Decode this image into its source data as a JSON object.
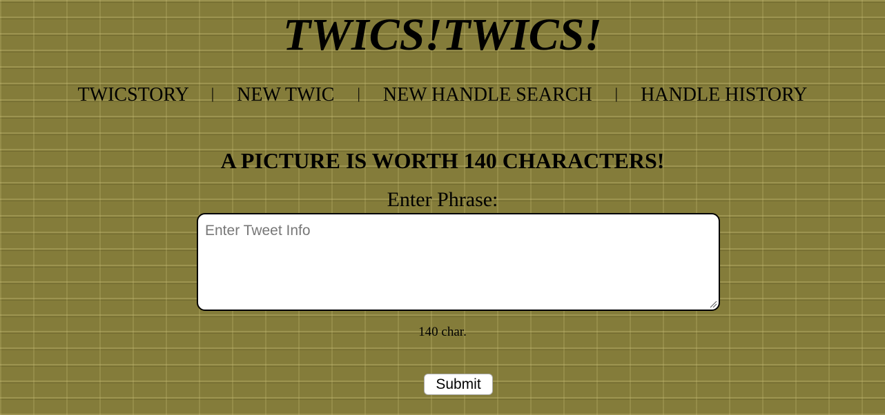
{
  "header": {
    "title": "TWICS!TWICS!"
  },
  "nav": {
    "items": [
      {
        "label": "TWICSTORY"
      },
      {
        "label": "NEW TWIC"
      },
      {
        "label": "NEW HANDLE SEARCH"
      },
      {
        "label": "HANDLE HISTORY"
      }
    ],
    "separator": "|"
  },
  "main": {
    "headline": "A PICTURE IS WORTH 140 CHARACTERS!",
    "phrase_label": "Enter Phrase:",
    "phrase_input": {
      "value": "",
      "placeholder": "Enter Tweet Info"
    },
    "char_counter": "140 char.",
    "submit_label": "Submit"
  },
  "colors": {
    "background": "#847c3a",
    "text": "#000000",
    "input_background": "#ffffff"
  }
}
